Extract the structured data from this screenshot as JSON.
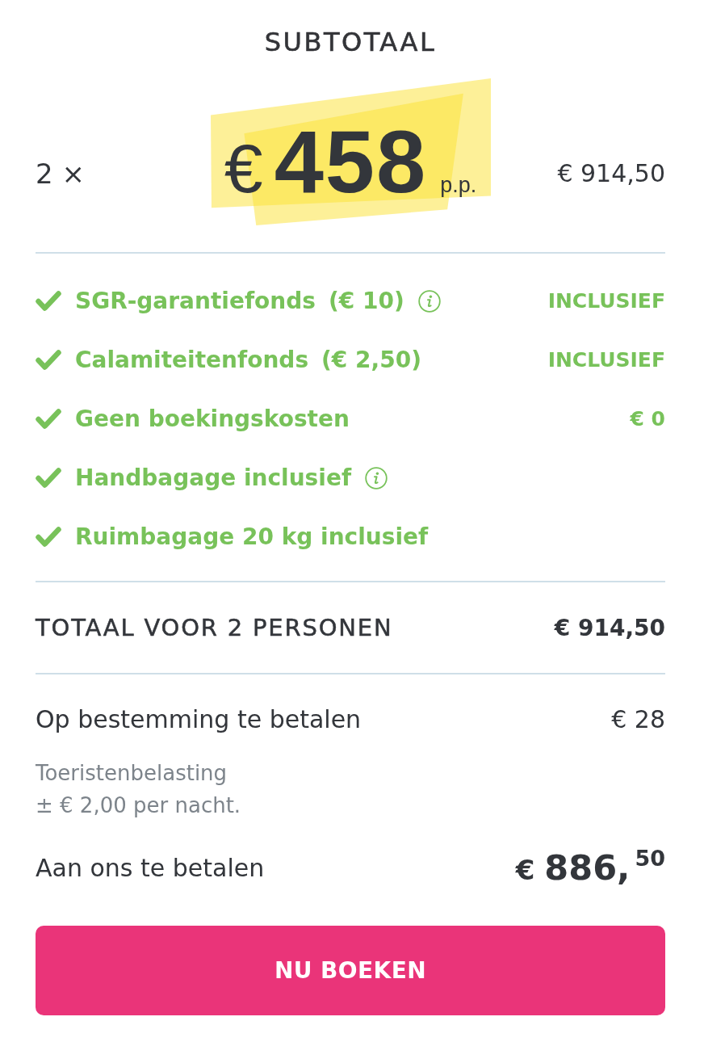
{
  "title": "SUBTOTAAL",
  "price": {
    "quantity": "2 ×",
    "currency": "€",
    "amount": "458",
    "unit": "p.p.",
    "total": "€ 914,50"
  },
  "items": [
    {
      "label": "SGR-garantiefonds",
      "detail": "(€ 10)",
      "info": true,
      "value": "INCLUSIEF"
    },
    {
      "label": "Calamiteitenfonds",
      "detail": "(€ 2,50)",
      "info": false,
      "value": "INCLUSIEF"
    },
    {
      "label": "Geen boekingskosten",
      "info": false,
      "value": "€ 0"
    },
    {
      "label": "Handbagage inclusief",
      "info": true
    },
    {
      "label": "Ruimbagage 20 kg inclusief",
      "info": false
    }
  ],
  "total": {
    "label": "TOTAAL VOOR 2 PERSONEN",
    "value": "€ 914,50"
  },
  "on_site": {
    "label": "Op bestemming te betalen",
    "value": "€ 28",
    "note": [
      "Toeristenbelasting",
      "± € 2,00 per nacht."
    ]
  },
  "due": {
    "label": "Aan ons te betalen",
    "currency": "€",
    "amount": "886,",
    "cents": "50"
  },
  "button": {
    "label": "NU BOEKEN"
  }
}
